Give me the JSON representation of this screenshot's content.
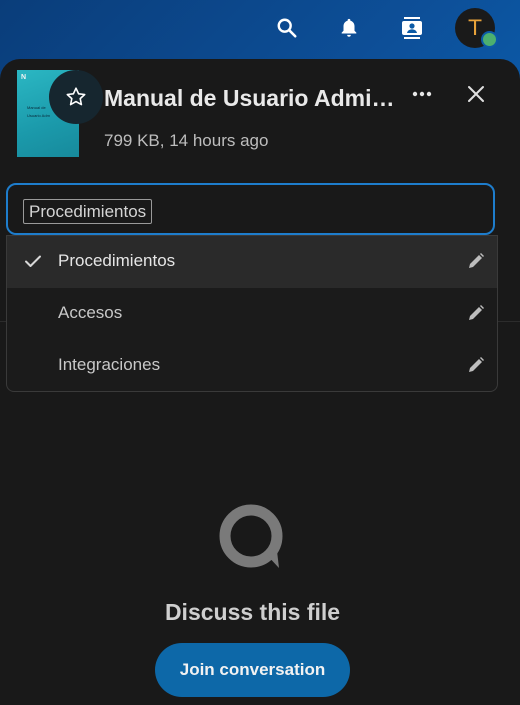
{
  "header": {
    "avatar_initial": "T",
    "status_color": "#4caf6f",
    "icons": [
      "search-icon",
      "bell-icon",
      "contacts-icon"
    ]
  },
  "file": {
    "thumbnail_logo": "N",
    "thumbnail_line1": "Manual de",
    "thumbnail_line2": "Usuario Adm",
    "title": "Manual de Usuario Administrador",
    "subtitle": "799 KB, 14 hours ago"
  },
  "tags": {
    "selected_chip": "Procedimientos",
    "options": [
      {
        "label": "Procedimientos",
        "selected": true
      },
      {
        "label": "Accesos",
        "selected": false
      },
      {
        "label": "Integraciones",
        "selected": false
      }
    ]
  },
  "empty_state": {
    "heading": "Discuss this file",
    "button_label": "Join conversation"
  },
  "colors": {
    "accent": "#0d68a8",
    "focus_border": "#1e7dcc",
    "panel_bg": "#191919"
  }
}
